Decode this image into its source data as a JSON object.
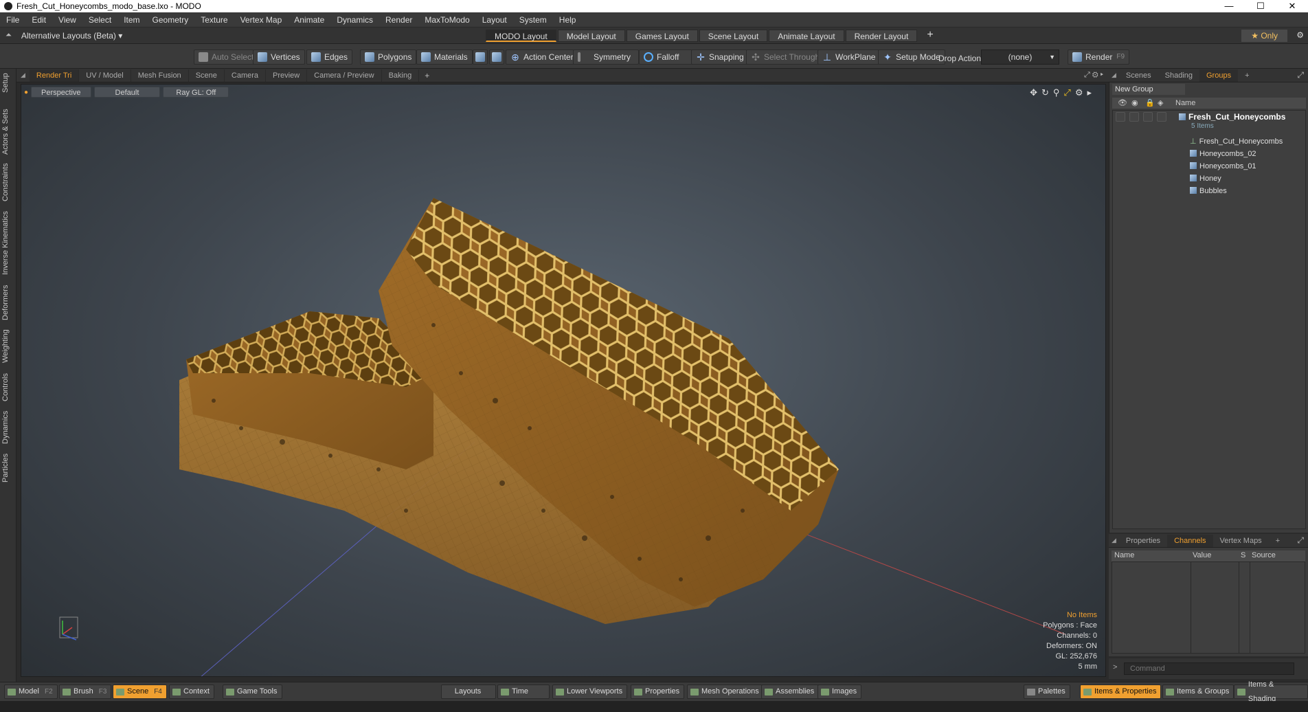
{
  "window": {
    "title": "Fresh_Cut_Honeycombs_modo_base.lxo - MODO",
    "minimize": "—",
    "maximize": "☐",
    "close": "✕"
  },
  "menu": [
    "File",
    "Edit",
    "View",
    "Select",
    "Item",
    "Geometry",
    "Texture",
    "Vertex Map",
    "Animate",
    "Dynamics",
    "Render",
    "MaxToModo",
    "Layout",
    "System",
    "Help"
  ],
  "layout_bar": {
    "alternative": "Alternative Layouts (Beta) ▾",
    "tabs": [
      "MODO Layout",
      "Model Layout",
      "Games Layout",
      "Scene Layout",
      "Animate Layout",
      "Render Layout"
    ],
    "active_tab": "MODO Layout",
    "plus": "+",
    "only": "★  Only"
  },
  "toolbar": {
    "auto_select": "Auto Select",
    "vertices": "Vertices",
    "edges": "Edges",
    "polygons": "Polygons",
    "materials": "Materials",
    "action_center": "Action Center",
    "symmetry": "Symmetry",
    "falloff": "Falloff",
    "snapping": "Snapping",
    "select_through": "Select Through",
    "workplane": "WorkPlane",
    "setup_mode": "Setup Mode",
    "drop_action": "Drop Action",
    "drop_value": "(none)",
    "render": "Render",
    "render_key": "F9"
  },
  "left_tabs": [
    "Setup",
    "Actors & Sets",
    "Constraints",
    "Inverse Kinematics",
    "Deformers",
    "Weighting",
    "Controls",
    "Dynamics",
    "Particles"
  ],
  "viewport_tabs": [
    "Render Tri",
    "UV / Model",
    "Mesh Fusion",
    "Scene",
    "Camera",
    "Preview",
    "Camera / Preview",
    "Baking"
  ],
  "viewport_tab_active": "Render Tri",
  "viewport": {
    "view": "Perspective",
    "shading": "Default",
    "raygl": "Ray GL: Off",
    "stats": {
      "items": "No Items",
      "polygons": "Polygons : Face",
      "channels": "Channels: 0",
      "deformers": "Deformers: ON",
      "gl": "GL: 252,676",
      "unit": "5 mm"
    }
  },
  "right_tabs": [
    "Scenes",
    "Shading",
    "Groups"
  ],
  "right_tab_active": "Groups",
  "groups": {
    "new_group": "New Group",
    "name_header": "Name",
    "group_name": "Fresh_Cut_Honeycombs",
    "group_count": "5 Items",
    "items": [
      "Fresh_Cut_Honeycombs",
      "Honeycombs_02",
      "Honeycombs_01",
      "Honey",
      "Bubbles"
    ]
  },
  "props_tabs": [
    "Properties",
    "Channels",
    "Vertex Maps"
  ],
  "props_tab_active": "Channels",
  "channels_header": {
    "name": "Name",
    "value": "Value",
    "s": "S",
    "source": "Source"
  },
  "command_placeholder": "Command",
  "bottom": {
    "model": "Model",
    "model_key": "F2",
    "brush": "Brush",
    "brush_key": "F3",
    "scene": "Scene",
    "scene_key": "F4",
    "context": "Context",
    "game_tools": "Game Tools",
    "layouts": "Layouts",
    "time": "Time",
    "lower_viewports": "Lower Viewports",
    "properties": "Properties",
    "mesh_operations": "Mesh Operations",
    "assemblies": "Assemblies",
    "images": "Images",
    "palettes": "Palettes",
    "items_properties": "Items & Properties",
    "items_groups": "Items & Groups",
    "items_shading": "Items & Shading"
  },
  "colors": {
    "accent": "#f0a030",
    "viewport_bg": "#4a535c",
    "honey": "#b07a2a"
  }
}
